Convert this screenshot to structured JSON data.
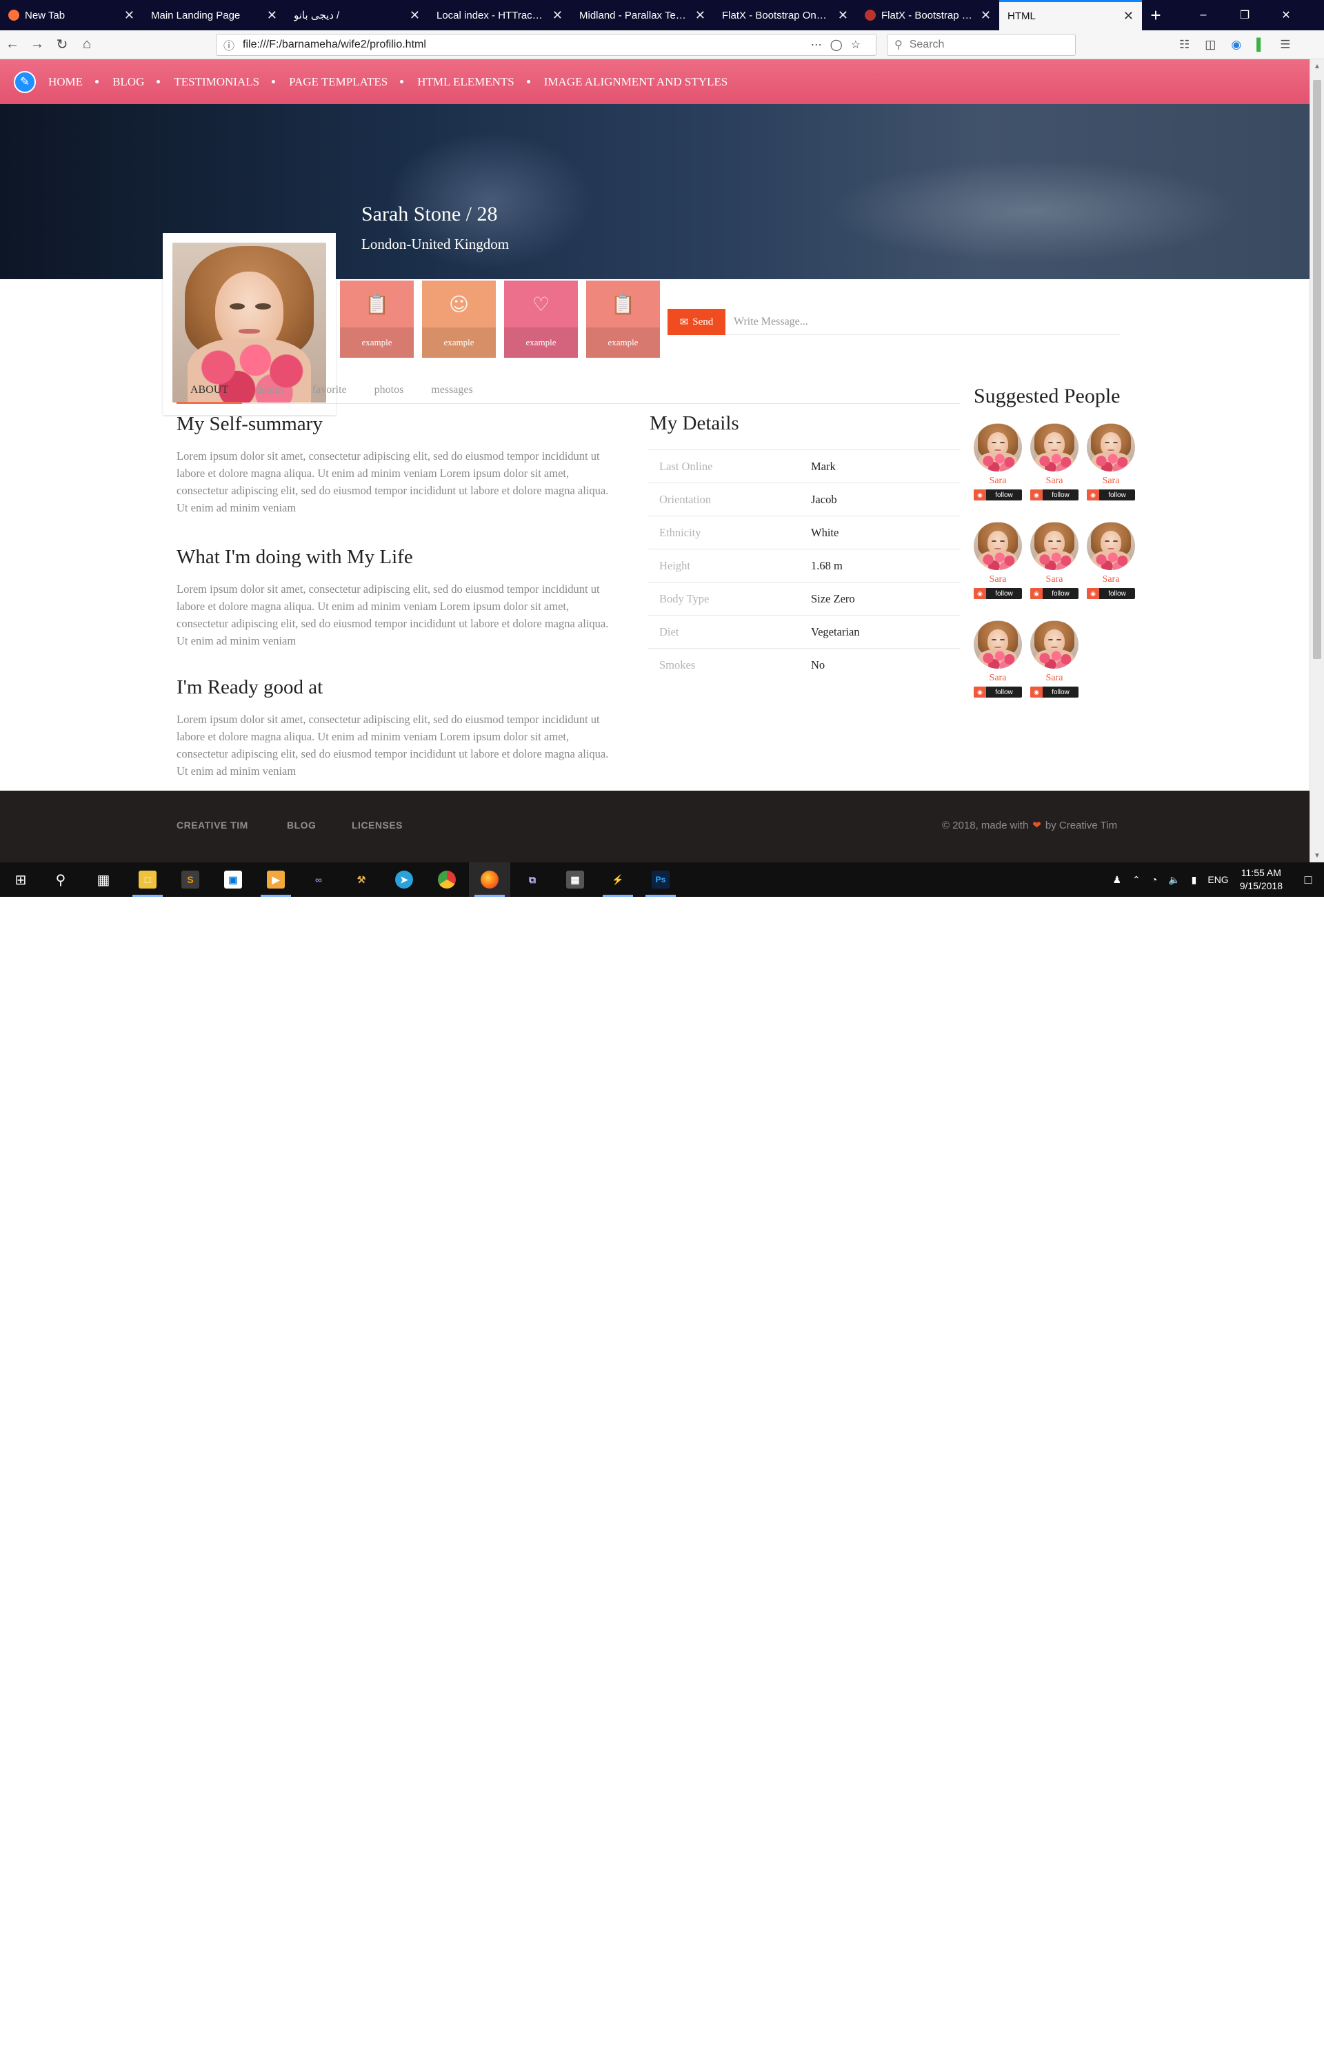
{
  "browser": {
    "tabs": [
      {
        "title": "New Tab",
        "favicon_color": "#ff7139"
      },
      {
        "title": "Main Landing Page",
        "favicon_color": ""
      },
      {
        "title": "دیجی بانو /",
        "favicon_color": ""
      },
      {
        "title": "Local index - HTTrack Website Copier",
        "favicon_color": ""
      },
      {
        "title": "Midland - Parallax Template",
        "favicon_color": ""
      },
      {
        "title": "FlatX - Bootstrap Onepage",
        "favicon_color": ""
      },
      {
        "title": "FlatX - Bootstrap One",
        "favicon_color": "#b9342c"
      },
      {
        "title": "HTML",
        "favicon_color": ""
      }
    ],
    "active_tab": 7,
    "url": "file:///F:/barnameha/wife2/profilio.html",
    "search_placeholder": "Search"
  },
  "site": {
    "nav": [
      "HOME",
      "BLOG",
      "TESTIMONIALS",
      "PAGE TEMPLATES",
      "HTML ELEMENTS",
      "IMAGE ALIGNMENT AND STYLES"
    ],
    "brand_color": "#e8576f"
  },
  "profile": {
    "name_age": "Sarah Stone / 28",
    "location": "London-United Kingdom"
  },
  "actions": [
    {
      "label": "example",
      "icon": "clipboard-icon",
      "color": "#f08a7e"
    },
    {
      "label": "example",
      "icon": "user-circle-icon",
      "color": "#f0a074"
    },
    {
      "label": "example",
      "icon": "heart-icon",
      "color": "#ec6f8c"
    },
    {
      "label": "example",
      "icon": "clipboard-icon",
      "color": "#f0877c"
    }
  ],
  "message": {
    "send_label": "Send",
    "placeholder": "Write Message..."
  },
  "tabs": [
    "ABOUT",
    "details",
    "favorite",
    "photos",
    "messages"
  ],
  "active_tab": 0,
  "sections": [
    {
      "title": "My Self-summary",
      "body": "Lorem ipsum dolor sit amet, consectetur adipiscing elit, sed do eiusmod tempor incididunt ut labore et dolore magna aliqua. Ut enim ad minim veniam Lorem ipsum dolor sit amet, consectetur adipiscing elit, sed do eiusmod tempor incididunt ut labore et dolore magna aliqua. Ut enim ad minim veniam"
    },
    {
      "title": "What I'm doing with My Life",
      "body": "Lorem ipsum dolor sit amet, consectetur adipiscing elit, sed do eiusmod tempor incididunt ut labore et dolore magna aliqua. Ut enim ad minim veniam Lorem ipsum dolor sit amet, consectetur adipiscing elit, sed do eiusmod tempor incididunt ut labore et dolore magna aliqua. Ut enim ad minim veniam"
    },
    {
      "title": "I'm Ready good at",
      "body": "Lorem ipsum dolor sit amet, consectetur adipiscing elit, sed do eiusmod tempor incididunt ut labore et dolore magna aliqua. Ut enim ad minim veniam Lorem ipsum dolor sit amet, consectetur adipiscing elit, sed do eiusmod tempor incididunt ut labore et dolore magna aliqua. Ut enim ad minim veniam"
    }
  ],
  "details": {
    "title": "My Details",
    "rows": [
      {
        "key": "Last Online",
        "value": "Mark"
      },
      {
        "key": "Orientation",
        "value": "Jacob"
      },
      {
        "key": "Ethnicity",
        "value": "White"
      },
      {
        "key": "Height",
        "value": "1.68 m"
      },
      {
        "key": "Body Type",
        "value": "Size Zero"
      },
      {
        "key": "Diet",
        "value": "Vegetarian"
      },
      {
        "key": "Smokes",
        "value": "No"
      }
    ]
  },
  "suggested": {
    "title": "Suggested People",
    "people": [
      {
        "name": "Sara",
        "follow_label": "follow"
      },
      {
        "name": "Sara",
        "follow_label": "follow"
      },
      {
        "name": "Sara",
        "follow_label": "follow"
      },
      {
        "name": "Sara",
        "follow_label": "follow"
      },
      {
        "name": "Sara",
        "follow_label": "follow"
      },
      {
        "name": "Sara",
        "follow_label": "follow"
      },
      {
        "name": "Sara",
        "follow_label": "follow"
      },
      {
        "name": "Sara",
        "follow_label": "follow"
      }
    ]
  },
  "footer": {
    "links": [
      "CREATIVE TIM",
      "BLOG",
      "LICENSES"
    ],
    "copyright_prefix": "© 2018, made with",
    "copyright_suffix": "by Creative Tim"
  },
  "taskbar": {
    "language": "ENG",
    "time": "11:55 AM",
    "date": "9/15/2018"
  }
}
